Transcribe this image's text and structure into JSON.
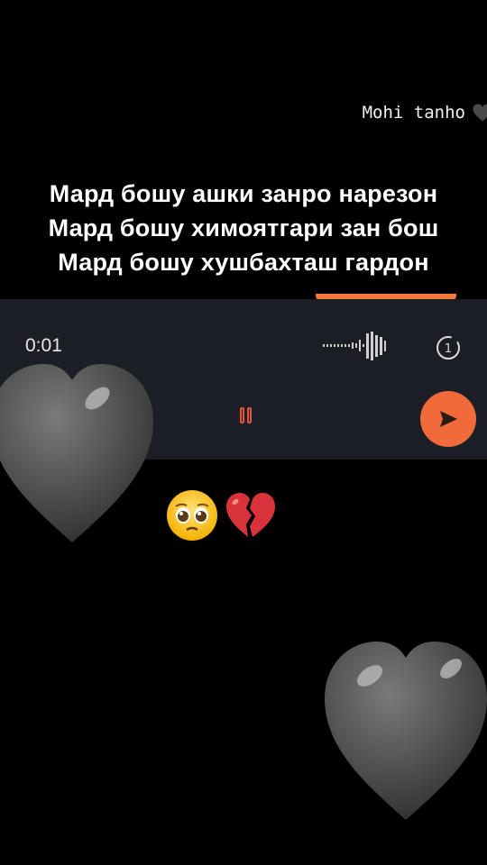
{
  "watermark": {
    "text": "Mohi tanho",
    "icon": "black-heart-icon"
  },
  "lyrics": {
    "line1": "Мард бошу ашки занро нарезон",
    "line2": "Мард бошу химоятгари зан бош",
    "line3": "Мард бошу хушбахташ гардон"
  },
  "voice_recorder": {
    "elapsed": "0:01",
    "once_label": "1",
    "accent": "#f06a3a",
    "bar_color": "#1b1f25"
  },
  "emojis": [
    "pleading-face-icon",
    "broken-heart-icon"
  ],
  "decor": {
    "heart_color": "#555555"
  }
}
